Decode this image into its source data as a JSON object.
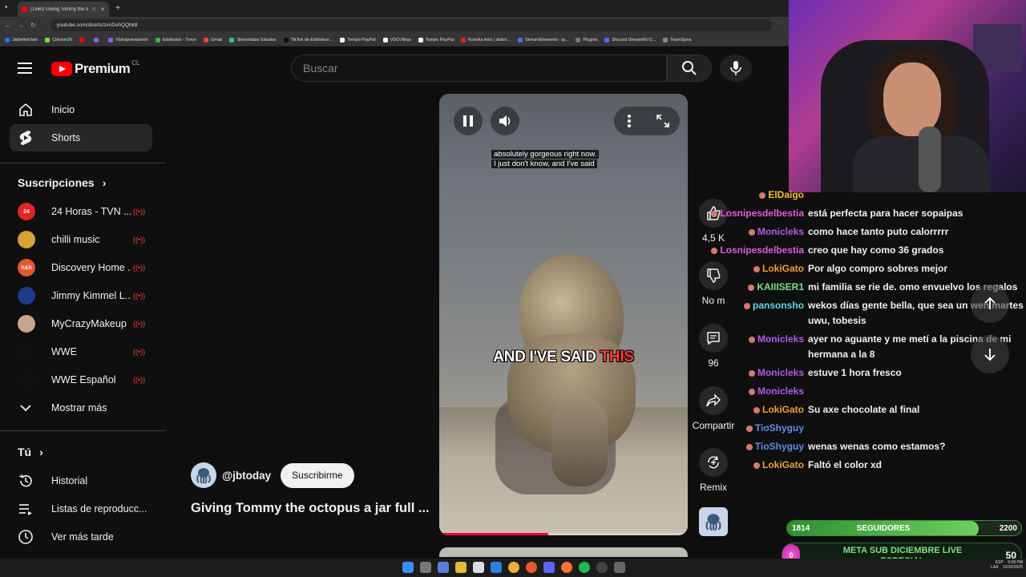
{
  "browser": {
    "tab_title": "(1560) Giving Tommy the o",
    "url": "youtube.com/shorts/zvnDvhQQhk8",
    "bookmarks": [
      "Jaidefinichon",
      "Cbloom26",
      "",
      "",
      "Vistrapreviaonlin",
      "Eddiesick - Trovo",
      "Gmail",
      "Streamlabs Saludos",
      "TikTok de Eddiebue...",
      "Tempo PayPal",
      "VDO.Ninja",
      "Tempo PayPal",
      "Komika Axis | dafon...",
      "StreamElements - ja...",
      "Plugins",
      "Discord StreamKit O...",
      "TeamSpea"
    ]
  },
  "header": {
    "logo_word": "Premium",
    "country": "CL",
    "search_placeholder": "Buscar"
  },
  "sidebar": {
    "home": "Inicio",
    "shorts": "Shorts",
    "subscriptions_title": "Suscripciones",
    "channels": [
      {
        "name": "24 Horas - TVN ...",
        "avatar": "24",
        "color": "#e02525"
      },
      {
        "name": "chilli music",
        "avatar": "",
        "color": "#d9a23b"
      },
      {
        "name": "Discovery Home ...",
        "avatar": "h&h",
        "color": "#e4572e"
      },
      {
        "name": "Jimmy Kimmel L...",
        "avatar": "",
        "color": "#1f3c88"
      },
      {
        "name": "MyCrazyMakeup",
        "avatar": "",
        "color": "#c9a38d"
      },
      {
        "name": "WWE",
        "avatar": "",
        "color": "#111111"
      },
      {
        "name": "WWE Español",
        "avatar": "",
        "color": "#111111"
      }
    ],
    "show_more": "Mostrar más",
    "you_title": "Tú",
    "history": "Historial",
    "playlists": "Listas de reproducc...",
    "watch_later": "Ver más tarde"
  },
  "short": {
    "handle": "@jbtoday",
    "subscribe": "Suscribirme",
    "title": "Giving Tommy the octopus a jar full ...",
    "caption_line1": "absolutely gorgeous right now.",
    "caption_line2": "I just don't know, and I've said",
    "big_caption_main": "AND I'VE SAID",
    "big_caption_highlight": "THIS",
    "progress": 0.44
  },
  "actions": {
    "likes": "4,5 K",
    "dislike_label": "No m",
    "comments": "96",
    "share": "Compartir",
    "remix": "Remix"
  },
  "chat": [
    {
      "user": "ElDaigo",
      "color": "#f0c030",
      "text": "",
      "top": 0
    },
    {
      "user": "Losnipesdelbestia",
      "color": "#e05bd8",
      "text": "está perfecta para hacer sopaipas"
    },
    {
      "user": "Monicleks",
      "color": "#b05be8",
      "text": "como hace tanto puto calorrrrr"
    },
    {
      "user": "Losnipesdelbestia",
      "color": "#e05bd8",
      "text": "creo que hay como 36 grados"
    },
    {
      "user": "LokiGato",
      "color": "#f0a030",
      "text": "Por algo compro sobres mejor"
    },
    {
      "user": "KAIIISER1",
      "color": "#7fe07f",
      "text": "mi familia se rie de. omo envuelvo los regalos"
    },
    {
      "user": "pansonsho",
      "color": "#5bd8e8",
      "text": "wekos días gente bella, que sea un wen martes"
    },
    {
      "user": "",
      "color": "#ffffff",
      "text": "uwu, tobesis"
    },
    {
      "user": "Monicleks",
      "color": "#b05be8",
      "text": "ayer no aguante y me metí a la piscina de mi"
    },
    {
      "user": "",
      "color": "#ffffff",
      "text": "hermana a la 8"
    },
    {
      "user": "Monicleks",
      "color": "#b05be8",
      "text": "estuve 1 hora fresco"
    },
    {
      "user": "Monicleks",
      "color": "#b05be8",
      "text": ""
    },
    {
      "user": "LokiGato",
      "color": "#f0a030",
      "text": "Su axe chocolate al final"
    },
    {
      "user": "TioShyguy",
      "color": "#5b8fe8",
      "text": ""
    },
    {
      "user": "TioShyguy",
      "color": "#5b8fe8",
      "text": "wenas wenas como estamos?"
    },
    {
      "user": "LokiGato",
      "color": "#f0a030",
      "text": "Faltó el color xd"
    }
  ],
  "goals": {
    "followers_current": "1814",
    "followers_label": "SEGUIDORES",
    "followers_target": "2200",
    "followers_progress": 0.82,
    "sub_current": "0",
    "sub_label_line1": "META SUB DICIEMBRE LIVE",
    "sub_label_line2": "ESPECIAL",
    "sub_target": "50"
  },
  "taskbar": {
    "lang": "ESP",
    "layout": "LAA",
    "time": "5:58 PM",
    "date": "12/30/2025"
  }
}
